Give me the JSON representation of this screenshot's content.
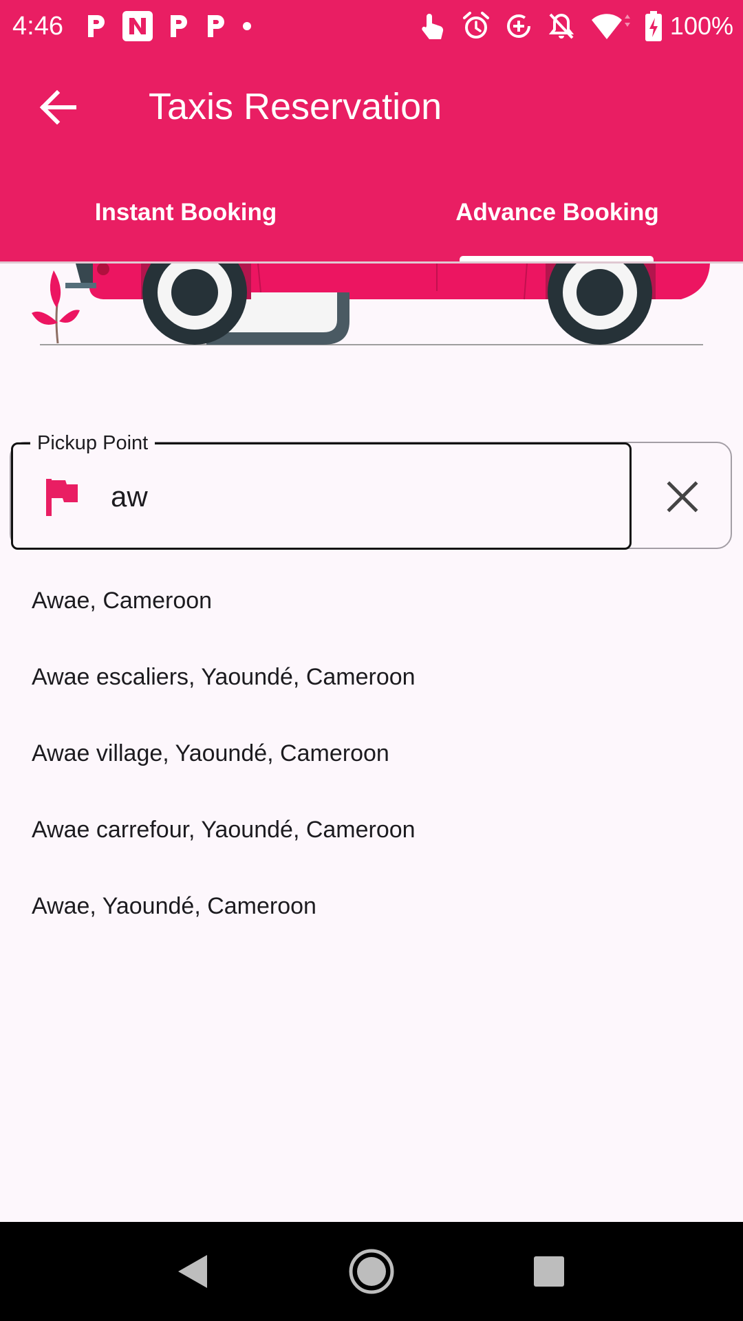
{
  "status_bar": {
    "time": "4:46",
    "battery": "100%",
    "icons": [
      "parking-icon",
      "n-app-icon",
      "parking-icon",
      "parking-icon",
      "dot-icon",
      "touch-icon",
      "alarm-icon",
      "data-saver-icon",
      "bell-off-icon",
      "wifi-icon",
      "battery-charging-icon"
    ]
  },
  "app_bar": {
    "title": "Taxis Reservation",
    "back_icon": "arrow-back-icon",
    "color": "#e91e63"
  },
  "tabs": [
    {
      "label": "Instant Booking",
      "selected": false
    },
    {
      "label": "Advance Booking",
      "selected": true
    }
  ],
  "illustration": {
    "description_icon": "taxi-car-illustration",
    "color": "#ec1561"
  },
  "pickup": {
    "label": "Pickup Point",
    "value": "aw",
    "icon": "flag-icon",
    "clear_icon": "close-icon"
  },
  "suggestions": [
    "Awae, Cameroon",
    "Awae escaliers, Yaoundé, Cameroon",
    "Awae village, Yaoundé, Cameroon",
    "Awae carrefour, Yaoundé, Cameroon",
    "Awae, Yaoundé, Cameroon"
  ],
  "nav_bar": {
    "icons": [
      "nav-back-icon",
      "nav-home-icon",
      "nav-recents-icon"
    ]
  }
}
